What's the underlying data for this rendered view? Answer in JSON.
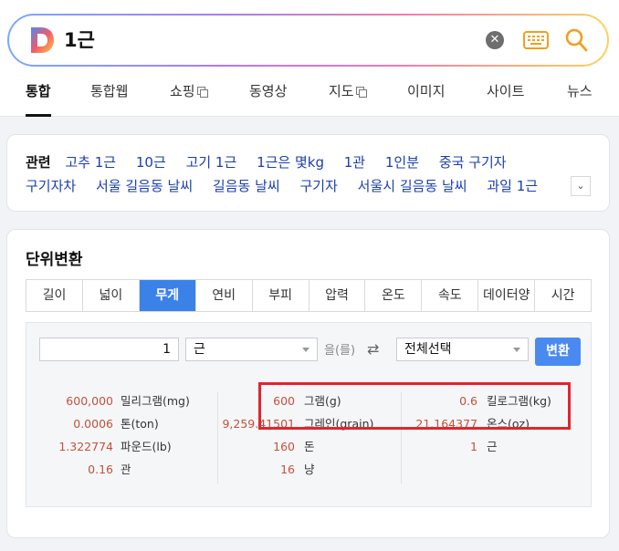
{
  "search": {
    "query": "1근"
  },
  "tabs": [
    {
      "label": "통합",
      "active": true
    },
    {
      "label": "통합웹"
    },
    {
      "label": "쇼핑",
      "icon": "external-box-icon"
    },
    {
      "label": "동영상"
    },
    {
      "label": "지도",
      "icon": "external-box-icon"
    },
    {
      "label": "이미지"
    },
    {
      "label": "사이트"
    },
    {
      "label": "뉴스"
    }
  ],
  "related": {
    "label": "관련",
    "line1": [
      "고추 1근",
      "10근",
      "고기 1근",
      "1근은 몇kg",
      "1관",
      "1인분",
      "중국 구기자"
    ],
    "line2": [
      "구기자차",
      "서울 길음동 날씨",
      "길음동 날씨",
      "구기자",
      "서울시 길음동 날씨",
      "과일 1근"
    ]
  },
  "converter": {
    "title": "단위변환",
    "unit_tabs": [
      "길이",
      "넓이",
      "무게",
      "연비",
      "부피",
      "압력",
      "온도",
      "속도",
      "데이터양",
      "시간"
    ],
    "active_tab": "무게",
    "input_value": "1",
    "from_unit": "근",
    "particle": "을(를)",
    "to_unit": "전체선택",
    "convert_label": "변환",
    "results": [
      [
        {
          "value": "600,000",
          "unit": "밀리그램(mg)"
        },
        {
          "value": "0.0006",
          "unit": "톤(ton)"
        },
        {
          "value": "1.322774",
          "unit": "파운드(lb)"
        },
        {
          "value": "0.16",
          "unit": "관"
        }
      ],
      [
        {
          "value": "600",
          "unit": "그램(g)"
        },
        {
          "value": "9,259.41501",
          "unit": "그레인(grain)"
        },
        {
          "value": "160",
          "unit": "돈"
        },
        {
          "value": "16",
          "unit": "냥"
        }
      ],
      [
        {
          "value": "0.6",
          "unit": "킬로그램(kg)"
        },
        {
          "value": "21.164377",
          "unit": "온스(oz)"
        },
        {
          "value": "1",
          "unit": "근"
        }
      ]
    ]
  },
  "colors": {
    "accent": "#3b82e8",
    "value_red": "#c4513a",
    "link_blue": "#1a3fb0",
    "highlight": "#e2242f"
  }
}
